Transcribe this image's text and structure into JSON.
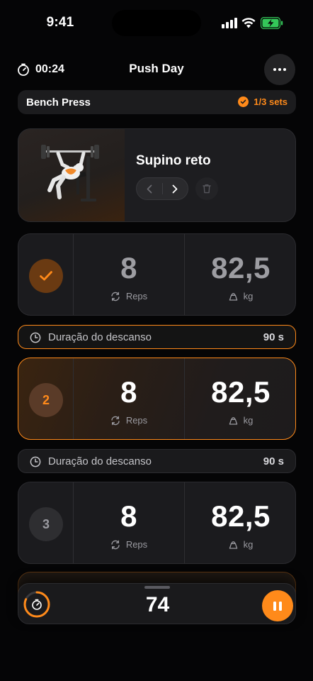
{
  "status_bar": {
    "time": "9:41"
  },
  "header": {
    "elapsed": "00:24",
    "title": "Push Day"
  },
  "exercise": {
    "name": "Bench Press",
    "sets_status": "1/3 sets",
    "variant": "Supino reto"
  },
  "sets": [
    {
      "badge": "",
      "state": "done",
      "reps": "8",
      "reps_label": "Reps",
      "weight": "82,5",
      "weight_label": "kg"
    },
    {
      "badge": "2",
      "state": "current",
      "reps": "8",
      "reps_label": "Reps",
      "weight": "82,5",
      "weight_label": "kg"
    },
    {
      "badge": "3",
      "state": "pending",
      "reps": "8",
      "reps_label": "Reps",
      "weight": "82,5",
      "weight_label": "kg"
    }
  ],
  "rests": [
    {
      "label": "Duração do descanso",
      "value": "90 s"
    },
    {
      "label": "Duração do descanso",
      "value": "90 s"
    }
  ],
  "rest_timer": {
    "countdown": "74",
    "progress": 0.82
  },
  "colors": {
    "accent": "#ff8a1a",
    "background": "#050506",
    "card": "#1d1d20"
  }
}
